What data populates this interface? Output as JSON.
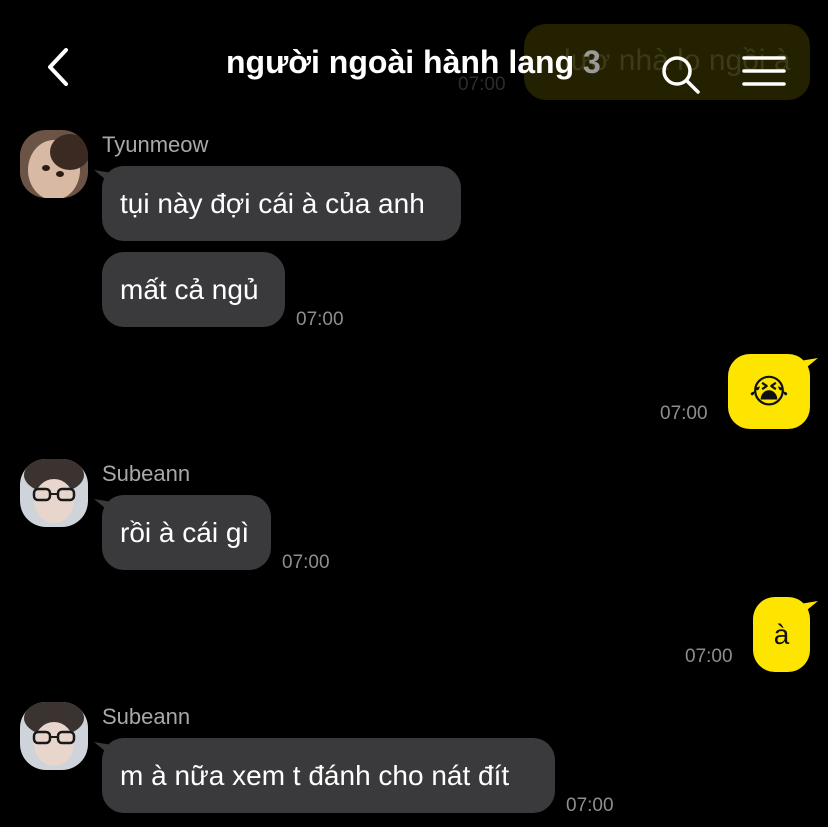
{
  "background_partial": {
    "text": "lươ nhà lo ngồi à",
    "time": "07:00"
  },
  "header": {
    "title": "người ngoài hành lang",
    "member_count": "3",
    "back_icon": "chevron-left-icon",
    "search_icon": "search-icon",
    "menu_icon": "hamburger-menu-icon"
  },
  "messages": [
    {
      "sender": "Tyunmeow",
      "avatar_icon": "avatar-tyunmeow",
      "bubbles": [
        "tụi này đợi cái à của anh",
        "mất cả ngủ"
      ],
      "time": "07:00"
    },
    {
      "sender": "me",
      "bubbles": [
        "😭"
      ],
      "time": "07:00"
    },
    {
      "sender": "Subeann",
      "avatar_icon": "avatar-subeann",
      "bubbles": [
        "rồi à cái gì"
      ],
      "time": "07:00"
    },
    {
      "sender": "me",
      "bubbles": [
        "à"
      ],
      "time": "07:00"
    },
    {
      "sender": "Subeann",
      "avatar_icon": "avatar-subeann",
      "bubbles": [
        "m à nữa xem t đánh cho nát đít"
      ],
      "time": "07:00"
    }
  ],
  "colors": {
    "background": "#000000",
    "incoming_bubble": "#3a3a3c",
    "outgoing_bubble": "#fee500",
    "timestamp": "#8e8e8e",
    "sender_name": "#a8a8a8"
  }
}
